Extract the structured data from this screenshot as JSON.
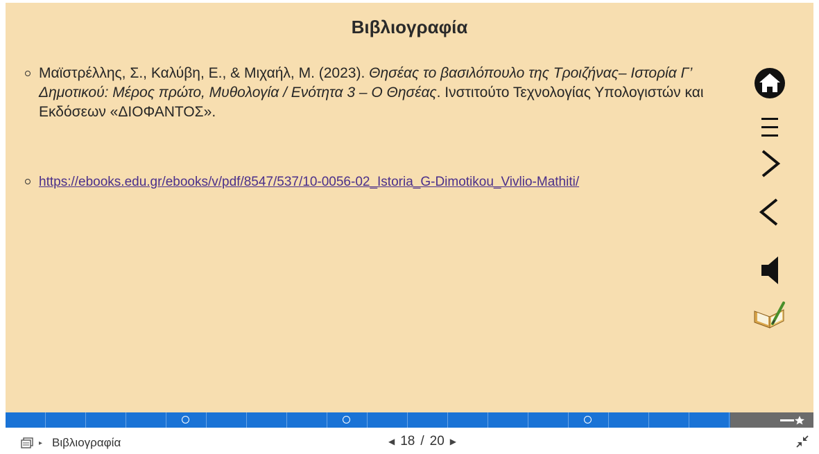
{
  "slide": {
    "title": "Βιβλιογραφία",
    "references": [
      {
        "authors": "Μαϊστρέλλης, Σ., Καλύβη, Ε., & Μιχαήλ, Μ. (2023). ",
        "title": "Θησέας  το βασιλόπουλο της Τροιζήνας– Ιστορία Γ’ Δημοτικού: Μέρος πρώτο, Μυθολογία / Ενότητα 3 – Ο Θησέας",
        "publisher": ". Ινστιτούτο Τεχνολογίας Υπολογιστών και Εκδόσεων «ΔΙΟΦΑΝΤΟΣ»."
      }
    ],
    "link": "https://ebooks.edu.gr/ebooks/v/pdf/8547/537/10-0056-02_Istoria_G-Dimotikou_Vivlio-Mathiti/"
  },
  "nav_icons": [
    "home-icon",
    "menu-icon",
    "next-icon",
    "previous-icon",
    "speaker-icon",
    "notebook-icon"
  ],
  "progress": {
    "current_slide": 18,
    "total_slides": 20,
    "section_markers": 3,
    "active_color": "#1a73d6",
    "inactive_color": "#6b6b6b"
  },
  "footer": {
    "breadcrumb": "Βιβλιογραφία",
    "page_current": "18",
    "page_separator": "/",
    "page_total": "20"
  },
  "colors": {
    "slide_background": "#f7deb0",
    "link": "#4a2f8a"
  }
}
